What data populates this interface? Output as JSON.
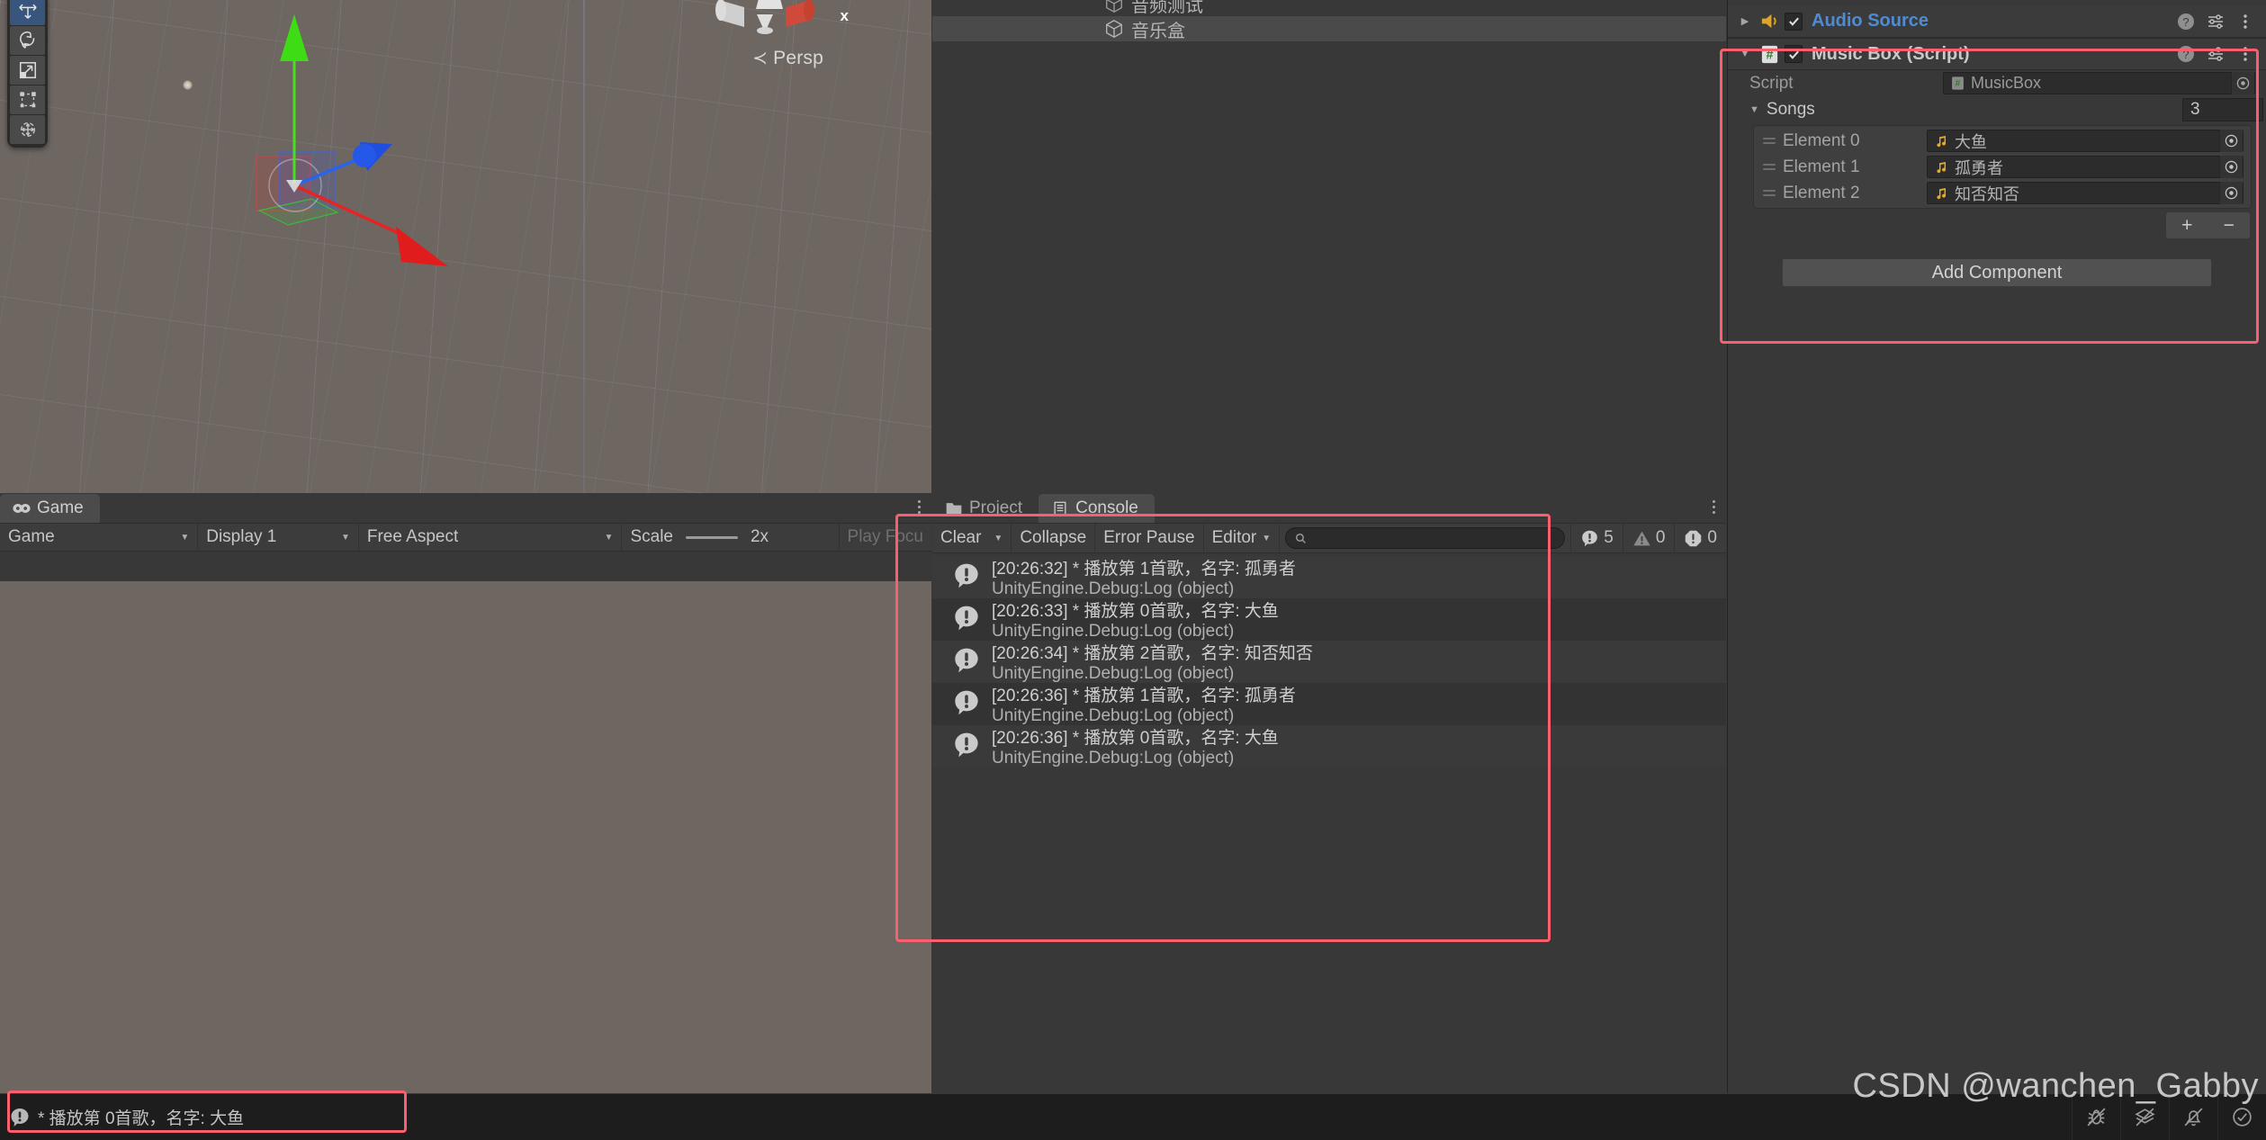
{
  "scene": {
    "persp_label": "Persp",
    "gizmo_axis_label": "x",
    "tools": [
      {
        "name": "move-tool",
        "icon": "move-icon",
        "active": true
      },
      {
        "name": "rotate-tool",
        "icon": "rotate-icon",
        "active": false
      },
      {
        "name": "scale-tool",
        "icon": "scale-icon",
        "active": false
      },
      {
        "name": "rect-tool",
        "icon": "rect-icon",
        "active": false
      },
      {
        "name": "transform-tool",
        "icon": "transform-icon",
        "active": false
      }
    ]
  },
  "hierarchy": {
    "items": [
      {
        "label": "音频测试",
        "selected": false
      },
      {
        "label": "音乐盒",
        "selected": true
      }
    ]
  },
  "inspector": {
    "components": [
      {
        "title": "Audio Source",
        "icon": "audio-source-icon",
        "enabled": true,
        "expanded": false,
        "is_link": true
      },
      {
        "title": "Music Box (Script)",
        "icon": "cs-script-icon",
        "enabled": true,
        "expanded": true,
        "is_link": false
      }
    ],
    "script_row": {
      "label": "Script",
      "value": "MusicBox"
    },
    "songs": {
      "label": "Songs",
      "count": "3",
      "elements": [
        {
          "label": "Element 0",
          "value": "大鱼"
        },
        {
          "label": "Element 1",
          "value": "孤勇者"
        },
        {
          "label": "Element 2",
          "value": "知否知否"
        }
      ],
      "add_label": "+",
      "remove_label": "−"
    },
    "add_component_label": "Add Component"
  },
  "game": {
    "tab_label": "Game",
    "toolbar": {
      "view_mode": "Game",
      "display": "Display 1",
      "aspect": "Free Aspect",
      "scale_label": "Scale",
      "scale_value": "2x",
      "play_focused": "Play Focu"
    }
  },
  "console": {
    "tabs": [
      {
        "label": "Project",
        "active": false,
        "icon": "folder-icon"
      },
      {
        "label": "Console",
        "active": true,
        "icon": "console-icon"
      }
    ],
    "toolbar": {
      "clear": "Clear",
      "collapse": "Collapse",
      "error_pause": "Error Pause",
      "editor": "Editor",
      "search_placeholder": ""
    },
    "counts": {
      "info": "5",
      "warning": "0",
      "error": "0"
    },
    "logs": [
      {
        "message": "[20:26:32] * 播放第 1首歌，名字: 孤勇者",
        "stack": "UnityEngine.Debug:Log (object)"
      },
      {
        "message": "[20:26:33] * 播放第 0首歌，名字: 大鱼",
        "stack": "UnityEngine.Debug:Log (object)"
      },
      {
        "message": "[20:26:34] * 播放第 2首歌，名字: 知否知否",
        "stack": "UnityEngine.Debug:Log (object)"
      },
      {
        "message": "[20:26:36] * 播放第 1首歌，名字: 孤勇者",
        "stack": "UnityEngine.Debug:Log (object)"
      },
      {
        "message": "[20:26:36] * 播放第 0首歌，名字: 大鱼",
        "stack": "UnityEngine.Debug:Log (object)"
      }
    ]
  },
  "status_bar": {
    "message": "* 播放第 0首歌，名字: 大鱼"
  },
  "watermark": "CSDN @wanchen_Gabby",
  "colors": {
    "accent_red": "#fb5e6e",
    "link_blue": "#4f8bd4",
    "panel_bg": "#383838",
    "scene_bg": "#6d6661",
    "audio_icon": "#e0a526"
  }
}
